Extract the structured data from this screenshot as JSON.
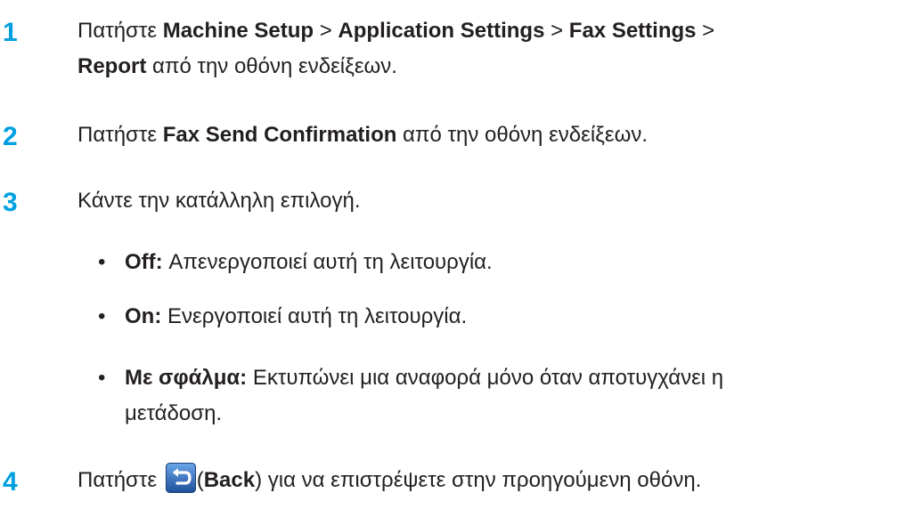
{
  "steps": [
    {
      "number": "1",
      "line1": {
        "pre": "Πατήστε ",
        "b1": "Machine Setup",
        "sep1": " > ",
        "b2": "Application Settings",
        "sep2": " > ",
        "b3": "Fax Settings",
        "sep3": " >"
      },
      "line2": {
        "b4": "Report",
        "post": " από την οθόνη ενδείξεων."
      }
    },
    {
      "number": "2",
      "pre": "Πατήστε ",
      "bold": "Fax Send Confirmation",
      "post": " από την οθόνη ενδείξεων."
    },
    {
      "number": "3",
      "text": "Κάντε την κατάλληλη επιλογή."
    },
    {
      "number": "4",
      "pre": "Πατήστε ",
      "paren_open": "(",
      "bold": "Back",
      "post": ") για να επιστρέψετε στην προηγούμενη οθόνη.",
      "icon": "back-arrow-icon"
    }
  ],
  "options": [
    {
      "bullet": "•",
      "label": "Off:",
      "desc": " Απενεργοποιεί αυτή τη λειτουργία."
    },
    {
      "bullet": "•",
      "label": "On:",
      "desc": " Ενεργοποιεί αυτή τη λειτουργία."
    },
    {
      "bullet": "•",
      "label": "Με σφάλμα:",
      "desc": " Εκτυπώνει μια αναφορά μόνο όταν αποτυγχάνει η",
      "desc_line2": "μετάδοση."
    }
  ],
  "colors": {
    "step_number": "#00a0e0",
    "text": "#231f20",
    "icon_blue": "#2f6fb5"
  }
}
